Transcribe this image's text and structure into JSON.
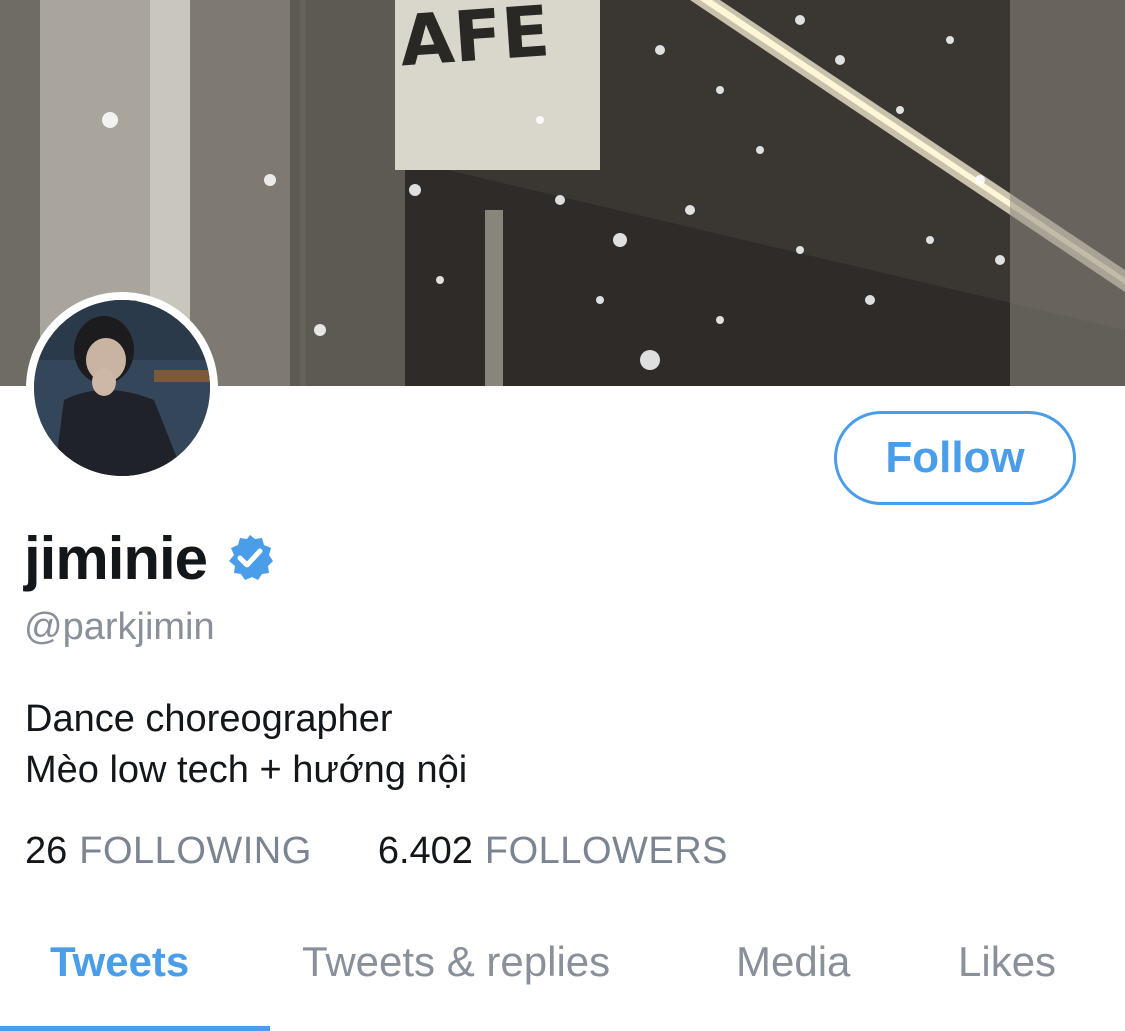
{
  "profile": {
    "display_name": "jiminie",
    "verified": true,
    "handle": "@parkjimin",
    "bio_lines": [
      "Dance choreographer",
      "Mèo low tech + hướng nội"
    ],
    "banner_sign_text": "AFE"
  },
  "actions": {
    "follow_label": "Follow"
  },
  "stats": {
    "following_count": "26",
    "following_label": "FOLLOWING",
    "followers_count": "6.402",
    "followers_label": "FOLLOWERS"
  },
  "tabs": [
    {
      "label": "Tweets",
      "active": true
    },
    {
      "label": "Tweets & replies",
      "active": false
    },
    {
      "label": "Media",
      "active": false
    },
    {
      "label": "Likes",
      "active": false
    }
  ],
  "colors": {
    "accent": "#4a9de8",
    "secondary_text": "#8a9099",
    "primary_text": "#14171a"
  },
  "icons": {
    "verified": "verified-badge-icon"
  }
}
